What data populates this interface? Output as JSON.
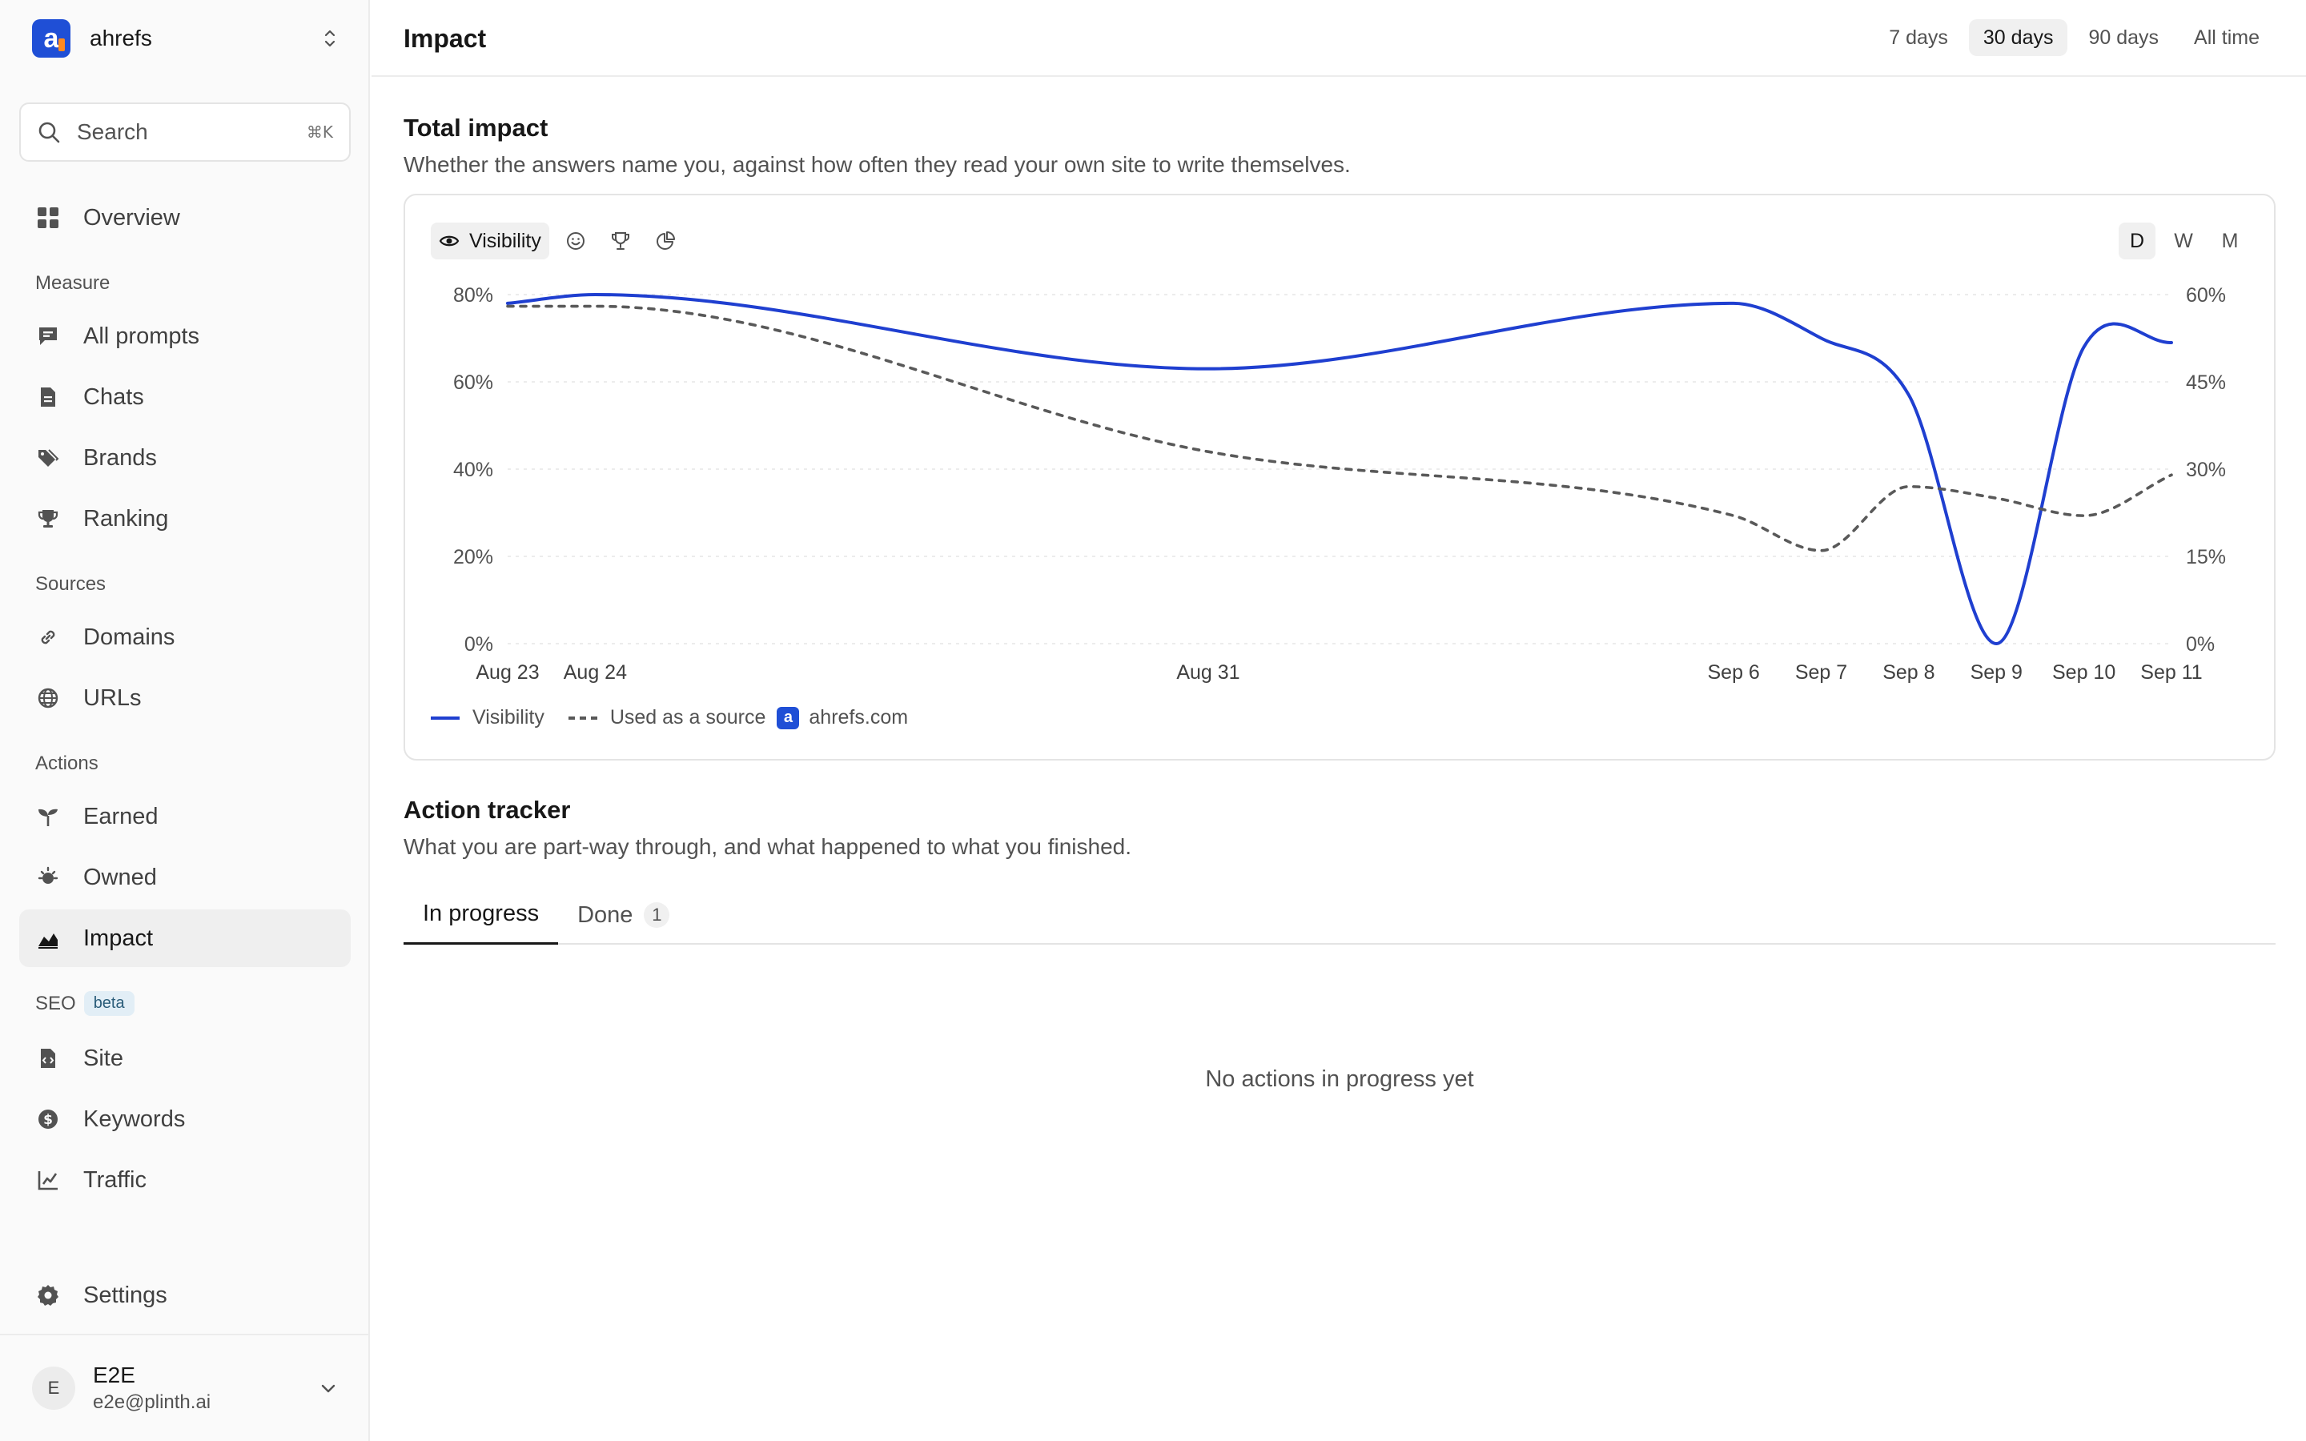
{
  "org": {
    "name": "ahrefs",
    "logo_letter": "a"
  },
  "search": {
    "label": "Search",
    "shortcut": "⌘K"
  },
  "nav": {
    "overview": "Overview",
    "measure_label": "Measure",
    "all_prompts": "All prompts",
    "chats": "Chats",
    "brands": "Brands",
    "ranking": "Ranking",
    "sources_label": "Sources",
    "domains": "Domains",
    "urls": "URLs",
    "actions_label": "Actions",
    "earned": "Earned",
    "owned": "Owned",
    "impact": "Impact",
    "seo_label": "SEO",
    "seo_badge": "beta",
    "site": "Site",
    "keywords": "Keywords",
    "traffic": "Traffic",
    "settings": "Settings"
  },
  "user": {
    "initial": "E",
    "name": "E2E",
    "email": "e2e@plinth.ai"
  },
  "header": {
    "title": "Impact",
    "ranges": [
      "7 days",
      "30 days",
      "90 days",
      "All time"
    ],
    "active_range": "30 days"
  },
  "total_impact": {
    "title": "Total impact",
    "description": "Whether the answers name you, against how often they read your own site to write themselves.",
    "visibility_button": "Visibility",
    "granularity": [
      "D",
      "W",
      "M"
    ],
    "active_granularity": "D",
    "legend": {
      "visibility": "Visibility",
      "source": "Used as a source",
      "domain": "ahrefs.com"
    }
  },
  "chart_data": {
    "type": "line",
    "x": [
      "Aug 23",
      "Aug 24",
      "Aug 31",
      "Sep 6",
      "Sep 7",
      "Sep 8",
      "Sep 9",
      "Sep 10",
      "Sep 11"
    ],
    "x_day_index": [
      0,
      1,
      8,
      14,
      15,
      16,
      17,
      18,
      19
    ],
    "series": [
      {
        "name": "Visibility",
        "axis": "left",
        "color": "#1f3fd0",
        "style": "solid",
        "values": [
          78,
          80,
          63,
          78,
          70,
          57,
          0,
          68,
          69
        ]
      },
      {
        "name": "Used as a source",
        "axis": "right",
        "color": "#595959",
        "style": "dashed",
        "values": [
          58,
          58,
          33,
          22,
          16,
          27,
          25,
          22,
          29
        ]
      }
    ],
    "y_left": {
      "ticks": [
        "0%",
        "20%",
        "40%",
        "60%",
        "80%"
      ],
      "range": [
        0,
        80
      ]
    },
    "y_right": {
      "ticks": [
        "0%",
        "15%",
        "30%",
        "45%",
        "60%"
      ],
      "range": [
        0,
        60
      ]
    },
    "grid": "horizontal-dashed"
  },
  "action_tracker": {
    "title": "Action tracker",
    "description": "What you are part-way through, and what happened to what you finished.",
    "tabs": {
      "in_progress": "In progress",
      "done": "Done",
      "done_count": "1"
    },
    "empty": "No actions in progress yet"
  }
}
